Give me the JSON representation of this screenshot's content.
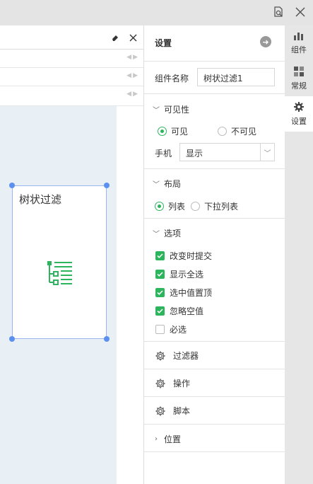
{
  "window": {
    "icons": [
      "preview-icon",
      "close-icon"
    ]
  },
  "editor": {
    "toolbar_icons": [
      "eraser-icon",
      "close-icon"
    ],
    "widget": {
      "title": "树状过滤",
      "icon": "tree-list-icon"
    }
  },
  "panel": {
    "title": "设置",
    "name_label": "组件名称",
    "name_value": "树状过滤1",
    "visibility": {
      "title": "可见性",
      "options": [
        "可见",
        "不可见"
      ],
      "selected": "可见",
      "mobile_label": "手机",
      "mobile_value": "显示"
    },
    "layout": {
      "title": "布局",
      "options": [
        "列表",
        "下拉列表"
      ],
      "selected": "列表"
    },
    "options": {
      "title": "选项",
      "items": [
        {
          "label": "改变时提交",
          "checked": true
        },
        {
          "label": "显示全选",
          "checked": true
        },
        {
          "label": "选中值置顶",
          "checked": true
        },
        {
          "label": "忽略空值",
          "checked": true
        },
        {
          "label": "必选",
          "checked": false
        }
      ]
    },
    "links": [
      {
        "label": "过滤器",
        "icon": "gear-icon"
      },
      {
        "label": "操作",
        "icon": "gear-icon"
      },
      {
        "label": "脚本",
        "icon": "gear-icon"
      }
    ],
    "position": {
      "title": "位置"
    }
  },
  "sidebar": {
    "tabs": [
      {
        "label": "组件",
        "icon": "bar-chart-icon"
      },
      {
        "label": "常规",
        "icon": "grid-icon"
      },
      {
        "label": "设置",
        "icon": "gear-icon",
        "active": true
      }
    ]
  },
  "colors": {
    "accent": "#2db55d",
    "selection": "#5b8ff0",
    "canvas": "#e8f0f5"
  }
}
